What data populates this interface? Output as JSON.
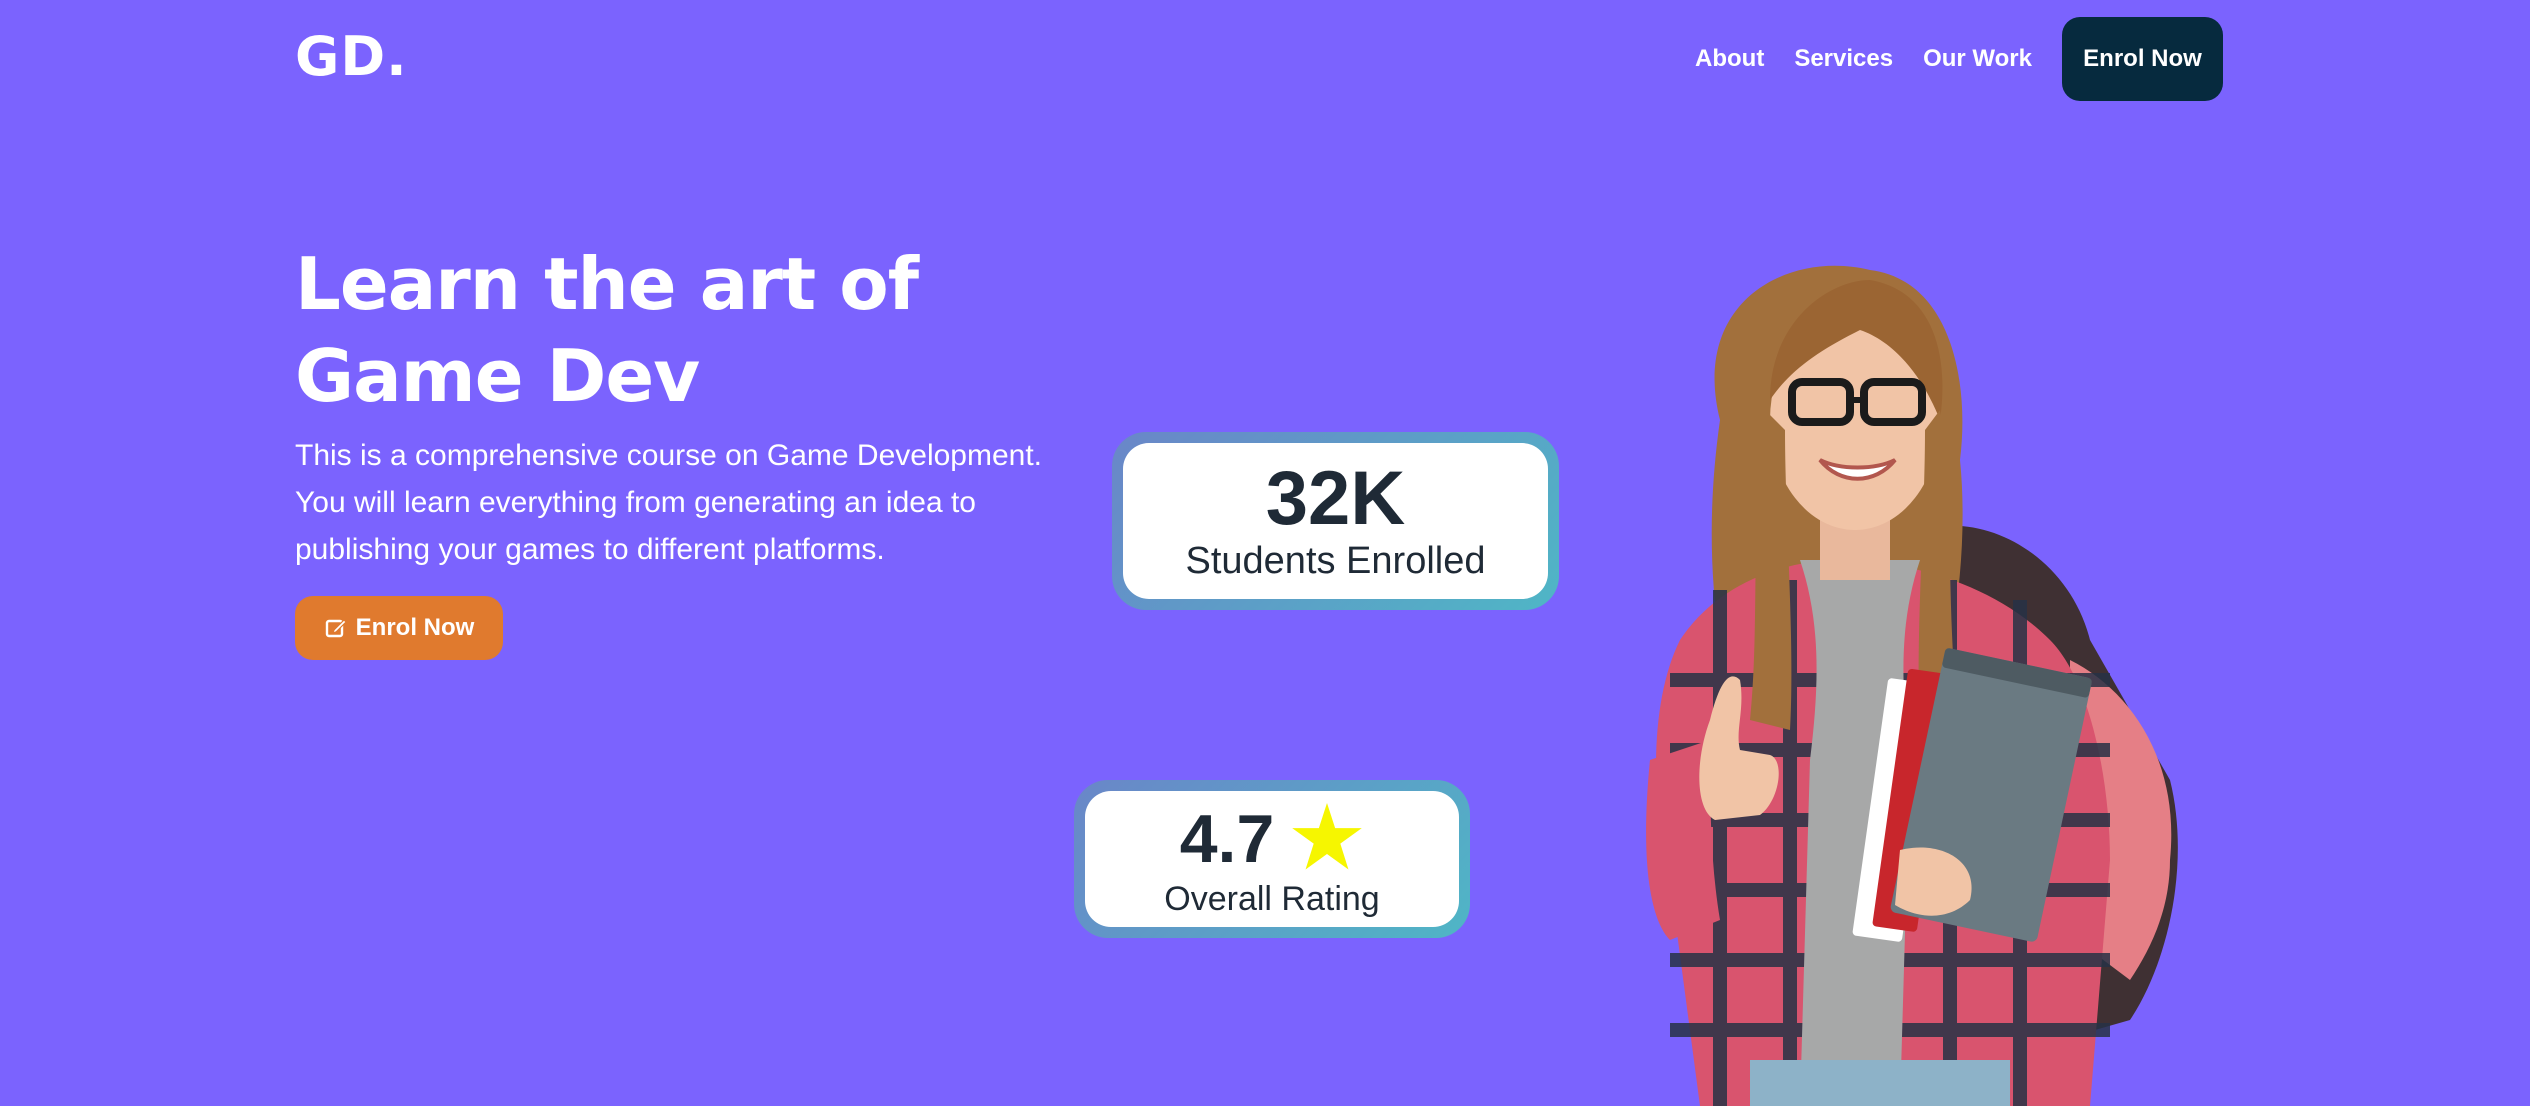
{
  "brand": {
    "logo_text": "GD."
  },
  "nav": {
    "links": [
      {
        "label": "About"
      },
      {
        "label": "Services"
      },
      {
        "label": "Our Work"
      }
    ],
    "cta_label": "Enrol Now"
  },
  "hero": {
    "title": "Learn the art of Game Dev",
    "description": "This is a comprehensive course on Game Development. You will learn everything from generating an idea to publishing your games to different platforms.",
    "cta_label": "Enrol Now",
    "cta_icon": "edit-icon"
  },
  "stats": {
    "students": {
      "value": "32K",
      "label": "Students Enrolled"
    },
    "rating": {
      "value": "4.7",
      "label": "Overall Rating",
      "icon": "star-icon"
    }
  },
  "colors": {
    "background": "#7b63fe",
    "nav_cta": "#062a3e",
    "hero_cta": "#e07a2e",
    "star": "#f6f600"
  }
}
